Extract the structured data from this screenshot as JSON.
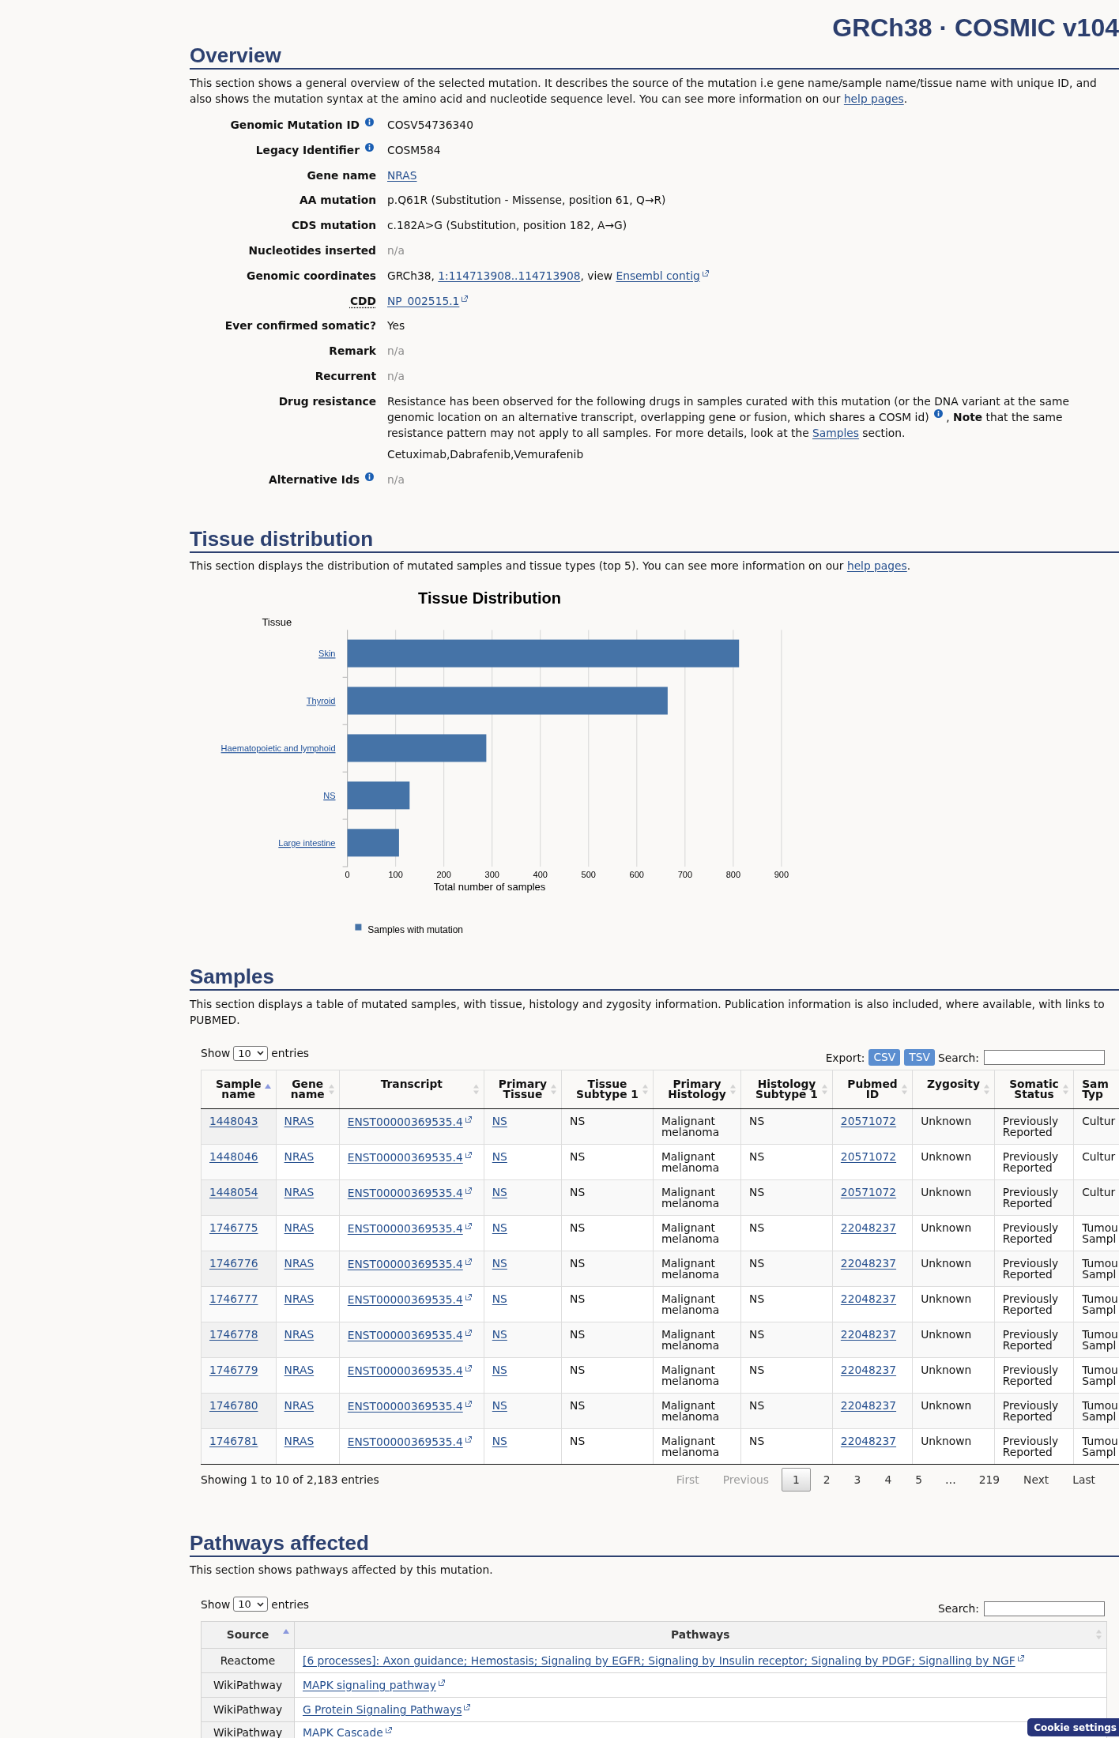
{
  "header": {
    "title": "GRCh38 · COSMIC v104"
  },
  "overview": {
    "heading": "Overview",
    "intro": [
      {
        "kind": "text",
        "text": "This section shows a general overview of the selected mutation. It describes the source of the mutation i.e gene name/sample name/tissue name with unique ID, and also shows the mutation syntax at the amino acid and nucleotide sequence level. You can see more information on our "
      },
      {
        "kind": "link",
        "text": "help pages"
      },
      {
        "kind": "text",
        "text": "."
      }
    ],
    "fields": [
      {
        "label": "Genomic Mutation ID",
        "info": true,
        "abbr": false,
        "value": [
          {
            "kind": "text",
            "text": "COSV54736340"
          }
        ]
      },
      {
        "label": "Legacy Identifier",
        "info": true,
        "abbr": false,
        "value": [
          {
            "kind": "text",
            "text": "COSM584"
          }
        ]
      },
      {
        "label": "Gene name",
        "info": false,
        "abbr": false,
        "value": [
          {
            "kind": "link",
            "text": "NRAS"
          }
        ]
      },
      {
        "label": "AA mutation",
        "info": false,
        "abbr": false,
        "value": [
          {
            "kind": "text",
            "text": "p.Q61R (Substitution - Missense, position 61, Q→R)"
          }
        ]
      },
      {
        "label": "CDS mutation",
        "info": false,
        "abbr": false,
        "value": [
          {
            "kind": "text",
            "text": "c.182A>G (Substitution, position 182, A→G)"
          }
        ]
      },
      {
        "label": "Nucleotides inserted",
        "info": false,
        "abbr": false,
        "value": [
          {
            "kind": "muted",
            "text": "n/a"
          }
        ]
      },
      {
        "label": "Genomic coordinates",
        "info": false,
        "abbr": false,
        "value": [
          {
            "kind": "text",
            "text": "GRCh38, "
          },
          {
            "kind": "link",
            "text": "1:114713908..114713908"
          },
          {
            "kind": "text",
            "text": ", view "
          },
          {
            "kind": "ext_link",
            "text": "Ensembl contig"
          }
        ]
      },
      {
        "label": "CDD",
        "info": false,
        "abbr": true,
        "value": [
          {
            "kind": "ext_link",
            "text": "NP_002515.1"
          }
        ]
      },
      {
        "label": "Ever confirmed somatic?",
        "info": false,
        "abbr": false,
        "value": [
          {
            "kind": "text",
            "text": "Yes"
          }
        ]
      },
      {
        "label": "Remark",
        "info": false,
        "abbr": false,
        "value": [
          {
            "kind": "muted",
            "text": "n/a"
          }
        ]
      },
      {
        "label": "Recurrent",
        "info": false,
        "abbr": false,
        "value": [
          {
            "kind": "muted",
            "text": "n/a"
          }
        ]
      },
      {
        "label": "Drug resistance",
        "info": false,
        "abbr": false,
        "value": [
          {
            "kind": "text",
            "text": "Resistance has been observed for the following drugs in samples curated with this mutation (or the DNA variant at the same genomic location on an alternative transcript, overlapping gene or fusion, which shares a COSM id) "
          },
          {
            "kind": "info"
          },
          {
            "kind": "text",
            "text": " , **Note** that the same resistance pattern may not apply to all samples. For more details, look at the "
          },
          {
            "kind": "link",
            "text": "Samples"
          },
          {
            "kind": "text",
            "text": " section."
          }
        ],
        "drugs": "Cetuximab,Dabrafenib,Vemurafenib"
      },
      {
        "label": "Alternative Ids",
        "info": true,
        "abbr": false,
        "value": [
          {
            "kind": "muted",
            "text": "n/a"
          }
        ]
      }
    ]
  },
  "tissue": {
    "heading": "Tissue distribution",
    "intro": [
      {
        "kind": "text",
        "text": "This section displays the distribution of mutated samples and tissue types (top 5). You can see more information on our "
      },
      {
        "kind": "link",
        "text": "help pages"
      },
      {
        "kind": "text",
        "text": "."
      }
    ],
    "chart_data": {
      "type": "bar",
      "orientation": "horizontal",
      "title": "Tissue Distribution",
      "xlabel": "Total number of samples",
      "ylabel": "Tissue",
      "categories": [
        "Skin",
        "Thyroid",
        "Haematopoietic and lymphoid",
        "NS",
        "Large intestine"
      ],
      "series": [
        {
          "name": "Samples with mutation",
          "color": "#4573a7",
          "values": [
            812,
            664,
            288,
            129,
            107
          ]
        }
      ],
      "xlim": [
        0,
        900
      ],
      "xticks": [
        0,
        100,
        200,
        300,
        400,
        500,
        600,
        700,
        800,
        900
      ],
      "grid": true
    }
  },
  "samples": {
    "heading": "Samples",
    "intro": [
      {
        "kind": "text",
        "text": "This section displays a table of mutated samples, with tissue, histology and zygosity information. Publication information is also included, where available, with links to PUBMED."
      }
    ],
    "controls": {
      "show_label": "Show",
      "page_size": "10",
      "entries_label": "entries",
      "export_label": "Export:",
      "export_buttons": [
        "CSV",
        "TSV"
      ],
      "search_label": "Search:"
    },
    "table": {
      "columns": [
        {
          "label": "Sample name",
          "kind": "link",
          "sorted": true
        },
        {
          "label": "Gene name",
          "kind": "link",
          "sorted": false
        },
        {
          "label": "Transcript",
          "kind": "ext_link",
          "sorted": false
        },
        {
          "label": "Primary Tissue",
          "kind": "link",
          "sorted": false
        },
        {
          "label": "Tissue Subtype 1",
          "kind": "text",
          "sorted": false
        },
        {
          "label": "Primary Histology",
          "kind": "text",
          "sorted": false
        },
        {
          "label": "Histology Subtype 1",
          "kind": "text",
          "sorted": false
        },
        {
          "label": "Pubmed ID",
          "kind": "link",
          "sorted": false
        },
        {
          "label": "Zygosity",
          "kind": "text",
          "sorted": false
        },
        {
          "label": "Somatic Status",
          "kind": "text",
          "sorted": false
        },
        {
          "label": "Sam Typ",
          "kind": "text"
        }
      ],
      "rows": [
        [
          "1448043",
          "NRAS",
          "ENST00000369535.4",
          "NS",
          "NS",
          "Malignant melanoma",
          "NS",
          "20571072",
          "Unknown",
          "Previously Reported",
          "Cultur"
        ],
        [
          "1448046",
          "NRAS",
          "ENST00000369535.4",
          "NS",
          "NS",
          "Malignant melanoma",
          "NS",
          "20571072",
          "Unknown",
          "Previously Reported",
          "Cultur"
        ],
        [
          "1448054",
          "NRAS",
          "ENST00000369535.4",
          "NS",
          "NS",
          "Malignant melanoma",
          "NS",
          "20571072",
          "Unknown",
          "Previously Reported",
          "Cultur"
        ],
        [
          "1746775",
          "NRAS",
          "ENST00000369535.4",
          "NS",
          "NS",
          "Malignant melanoma",
          "NS",
          "22048237",
          "Unknown",
          "Previously Reported",
          "Tumou Sampl"
        ],
        [
          "1746776",
          "NRAS",
          "ENST00000369535.4",
          "NS",
          "NS",
          "Malignant melanoma",
          "NS",
          "22048237",
          "Unknown",
          "Previously Reported",
          "Tumou Sampl"
        ],
        [
          "1746777",
          "NRAS",
          "ENST00000369535.4",
          "NS",
          "NS",
          "Malignant melanoma",
          "NS",
          "22048237",
          "Unknown",
          "Previously Reported",
          "Tumou Sampl"
        ],
        [
          "1746778",
          "NRAS",
          "ENST00000369535.4",
          "NS",
          "NS",
          "Malignant melanoma",
          "NS",
          "22048237",
          "Unknown",
          "Previously Reported",
          "Tumou Sampl"
        ],
        [
          "1746779",
          "NRAS",
          "ENST00000369535.4",
          "NS",
          "NS",
          "Malignant melanoma",
          "NS",
          "22048237",
          "Unknown",
          "Previously Reported",
          "Tumou Sampl"
        ],
        [
          "1746780",
          "NRAS",
          "ENST00000369535.4",
          "NS",
          "NS",
          "Malignant melanoma",
          "NS",
          "22048237",
          "Unknown",
          "Previously Reported",
          "Tumou Sampl"
        ],
        [
          "1746781",
          "NRAS",
          "ENST00000369535.4",
          "NS",
          "NS",
          "Malignant melanoma",
          "NS",
          "22048237",
          "Unknown",
          "Previously Reported",
          "Tumou Sampl"
        ]
      ]
    },
    "pagination": {
      "summary": "Showing 1 to 10 of 2,183 entries",
      "buttons": [
        {
          "label": "First",
          "kind": "button",
          "selected": false,
          "disabled": true
        },
        {
          "label": "Previous",
          "kind": "button",
          "selected": false,
          "disabled": true
        },
        {
          "label": "1",
          "kind": "button",
          "selected": true,
          "disabled": false
        },
        {
          "label": "2",
          "kind": "button",
          "selected": false,
          "disabled": false
        },
        {
          "label": "3",
          "kind": "button",
          "selected": false,
          "disabled": false
        },
        {
          "label": "4",
          "kind": "button",
          "selected": false,
          "disabled": false
        },
        {
          "label": "5",
          "kind": "button",
          "selected": false,
          "disabled": false
        },
        {
          "label": "…",
          "kind": "ellipsis"
        },
        {
          "label": "219",
          "kind": "button",
          "selected": false,
          "disabled": false
        },
        {
          "label": "Next",
          "kind": "button",
          "selected": false,
          "disabled": false
        },
        {
          "label": "Last",
          "kind": "button",
          "selected": false,
          "disabled": false
        }
      ]
    }
  },
  "pathways": {
    "heading": "Pathways affected",
    "intro": [
      {
        "kind": "text",
        "text": "This section shows pathways affected by this mutation."
      }
    ],
    "controls": {
      "show_label": "Show",
      "page_size": "10",
      "entries_label": "entries",
      "search_label": "Search:"
    },
    "table": {
      "columns": [
        {
          "label": "Source",
          "sorted": true
        },
        {
          "label": "Pathways",
          "sorted": false
        }
      ],
      "rows": [
        {
          "source": "Reactome",
          "pathway": "[6 processes]: Axon guidance; Hemostasis; Signaling by EGFR; Signaling by Insulin receptor; Signaling by PDGF; Signalling by NGF"
        },
        {
          "source": "WikiPathway",
          "pathway": "MAPK signaling pathway"
        },
        {
          "source": "WikiPathway",
          "pathway": "G Protein Signaling Pathways"
        },
        {
          "source": "WikiPathway",
          "pathway": "MAPK Cascade"
        }
      ]
    }
  },
  "cookie_button": "Cookie settings"
}
